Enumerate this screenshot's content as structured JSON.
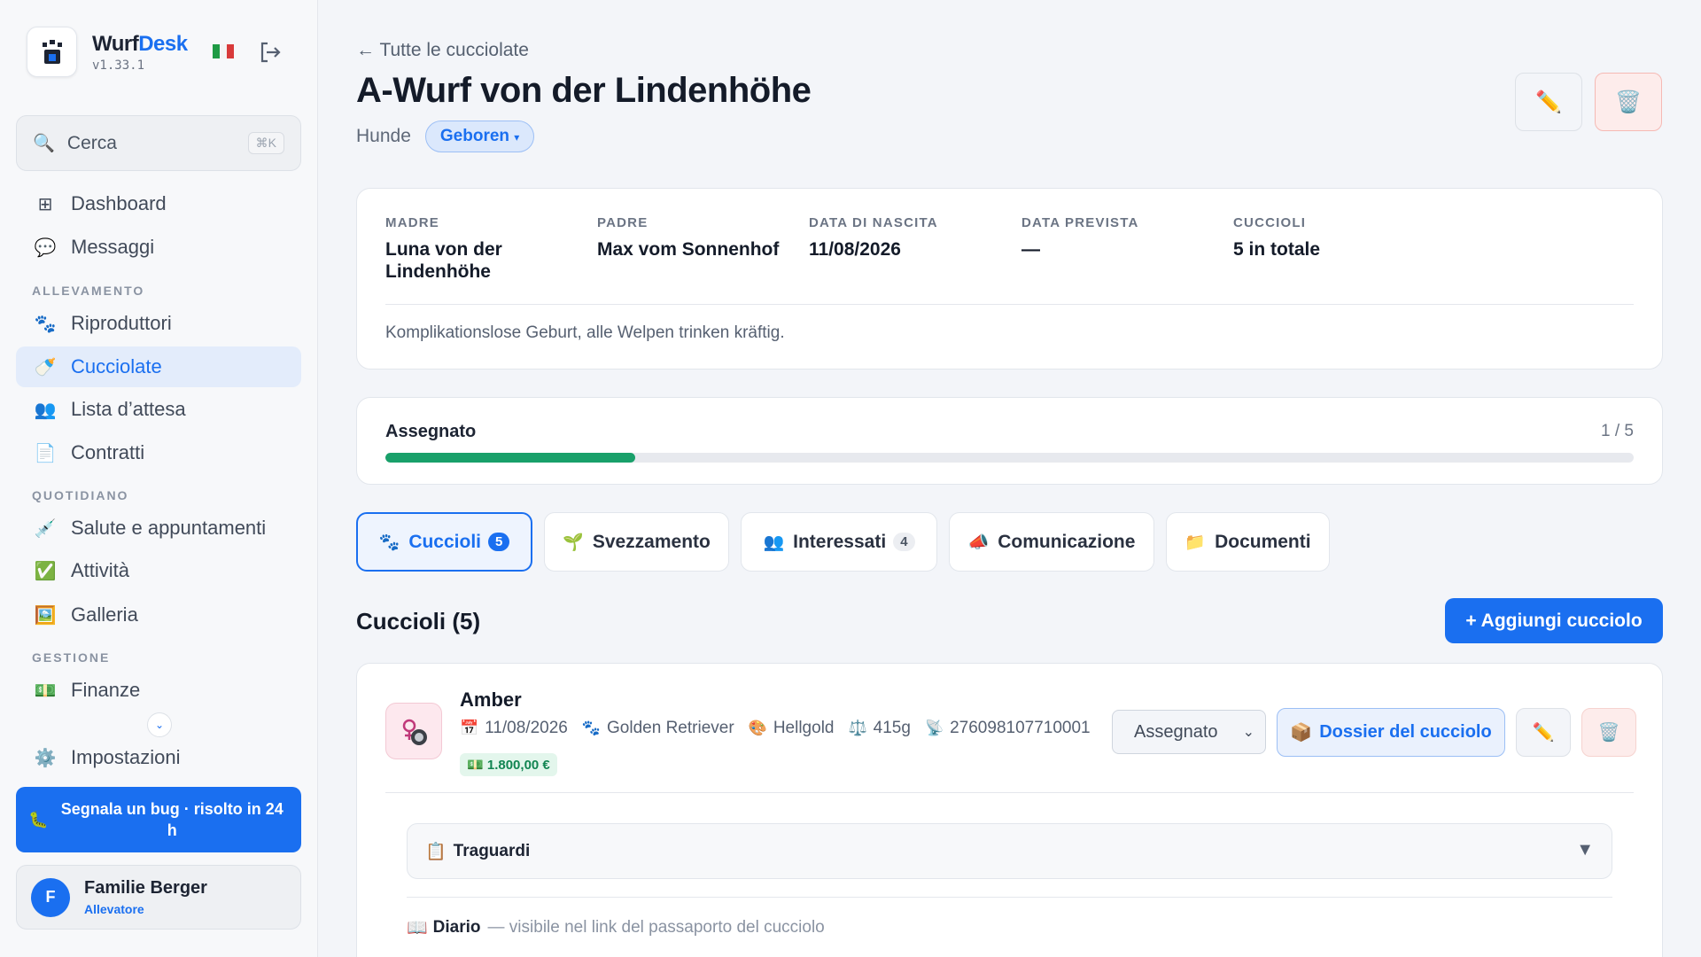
{
  "app": {
    "name_part1": "Wurf",
    "name_part2": "Desk",
    "version": "v1.33.1",
    "accent_color": "#1a6ff0",
    "language_flag_icon": "flag-italy-icon"
  },
  "sidebar": {
    "search": {
      "placeholder": "Cerca",
      "shortcut": "⌘K"
    },
    "items": [
      {
        "label": "Dashboard",
        "icon": "grid-icon"
      },
      {
        "label": "Messaggi",
        "icon": "chat-bubble-icon"
      },
      {
        "label": "Riproduttori",
        "icon": "paw-icon"
      },
      {
        "label": "Cucciolate",
        "icon": "baby-bottle-icon",
        "active": true
      },
      {
        "label": "Lista d’attesa",
        "icon": "people-icon"
      },
      {
        "label": "Contratti",
        "icon": "document-icon"
      },
      {
        "label": "Salute e appuntamenti",
        "icon": "syringe-icon"
      },
      {
        "label": "Attività",
        "icon": "checkmark-icon"
      },
      {
        "label": "Galleria",
        "icon": "picture-icon"
      },
      {
        "label": "Finanze",
        "icon": "money-icon"
      },
      {
        "label": "Impostazioni",
        "icon": "gear-icon"
      }
    ],
    "sections": {
      "breeding": "ALLEVAMENTO",
      "daily": "QUOTIDIANO",
      "management": "GESTIONE"
    },
    "bug_button": "Segnala un bug · risolto in 24 h",
    "user": {
      "initial": "F",
      "name": "Familie Berger",
      "role": "Allevatore"
    }
  },
  "header": {
    "back": "← Tutte le cucciolate",
    "title": "A-Wurf von der Lindenhöhe",
    "breed": "Hunde",
    "status": "Geboren"
  },
  "info": {
    "mother_label": "MADRE",
    "mother": "Luna von der Lindenhöhe",
    "father_label": "PADRE",
    "father": "Max vom Sonnenhof",
    "birth_label": "DATA DI NASCITA",
    "birth": "11/08/2026",
    "expected_label": "DATA PREVISTA",
    "expected": "—",
    "puppies_label": "CUCCIOLI",
    "puppies": "5 in totale",
    "note": "Komplikationslose Geburt, alle Welpen trinken kräftig."
  },
  "progress": {
    "label": "Assegnato",
    "count": "1 / 5",
    "fraction": 0.2
  },
  "tabs": [
    {
      "label": "Cuccioli",
      "badge": "5",
      "icon": "paw-icon"
    },
    {
      "label": "Svezzamento",
      "icon": "sprout-icon"
    },
    {
      "label": "Interessati",
      "badge": "4",
      "icon": "people-icon"
    },
    {
      "label": "Comunicazione",
      "icon": "megaphone-icon"
    },
    {
      "label": "Documenti",
      "icon": "folder-icon"
    }
  ],
  "section": {
    "title": "Cuccioli (5)",
    "add_button": "+ Aggiungi cucciolo"
  },
  "puppy": {
    "name": "Amber",
    "birth": "11/08/2026",
    "breed": "Golden Retriever",
    "color": "Hellgold",
    "weight": "415g",
    "chip": "276098107710001",
    "price": "1.800,00 €",
    "status": "Assegnato",
    "dossier_button": "Dossier del cucciolo",
    "milestones": "Traguardi",
    "diary_title": "Diario",
    "diary_hint": "— visibile nel link del passaporto del cucciolo"
  }
}
